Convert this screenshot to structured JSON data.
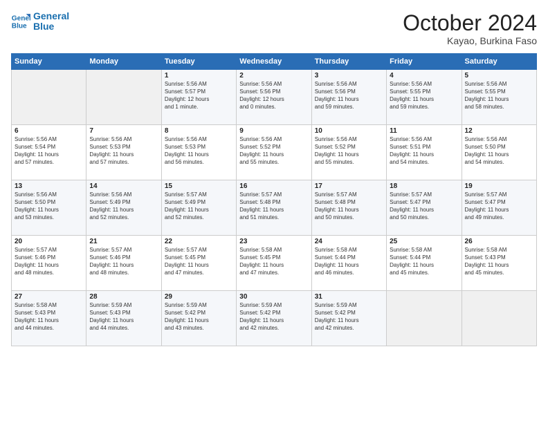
{
  "logo": {
    "line1": "General",
    "line2": "Blue"
  },
  "title": "October 2024",
  "location": "Kayao, Burkina Faso",
  "days_header": [
    "Sunday",
    "Monday",
    "Tuesday",
    "Wednesday",
    "Thursday",
    "Friday",
    "Saturday"
  ],
  "weeks": [
    [
      {
        "day": "",
        "info": ""
      },
      {
        "day": "",
        "info": ""
      },
      {
        "day": "1",
        "info": "Sunrise: 5:56 AM\nSunset: 5:57 PM\nDaylight: 12 hours\nand 1 minute."
      },
      {
        "day": "2",
        "info": "Sunrise: 5:56 AM\nSunset: 5:56 PM\nDaylight: 12 hours\nand 0 minutes."
      },
      {
        "day": "3",
        "info": "Sunrise: 5:56 AM\nSunset: 5:56 PM\nDaylight: 11 hours\nand 59 minutes."
      },
      {
        "day": "4",
        "info": "Sunrise: 5:56 AM\nSunset: 5:55 PM\nDaylight: 11 hours\nand 59 minutes."
      },
      {
        "day": "5",
        "info": "Sunrise: 5:56 AM\nSunset: 5:55 PM\nDaylight: 11 hours\nand 58 minutes."
      }
    ],
    [
      {
        "day": "6",
        "info": "Sunrise: 5:56 AM\nSunset: 5:54 PM\nDaylight: 11 hours\nand 57 minutes."
      },
      {
        "day": "7",
        "info": "Sunrise: 5:56 AM\nSunset: 5:53 PM\nDaylight: 11 hours\nand 57 minutes."
      },
      {
        "day": "8",
        "info": "Sunrise: 5:56 AM\nSunset: 5:53 PM\nDaylight: 11 hours\nand 56 minutes."
      },
      {
        "day": "9",
        "info": "Sunrise: 5:56 AM\nSunset: 5:52 PM\nDaylight: 11 hours\nand 55 minutes."
      },
      {
        "day": "10",
        "info": "Sunrise: 5:56 AM\nSunset: 5:52 PM\nDaylight: 11 hours\nand 55 minutes."
      },
      {
        "day": "11",
        "info": "Sunrise: 5:56 AM\nSunset: 5:51 PM\nDaylight: 11 hours\nand 54 minutes."
      },
      {
        "day": "12",
        "info": "Sunrise: 5:56 AM\nSunset: 5:50 PM\nDaylight: 11 hours\nand 54 minutes."
      }
    ],
    [
      {
        "day": "13",
        "info": "Sunrise: 5:56 AM\nSunset: 5:50 PM\nDaylight: 11 hours\nand 53 minutes."
      },
      {
        "day": "14",
        "info": "Sunrise: 5:56 AM\nSunset: 5:49 PM\nDaylight: 11 hours\nand 52 minutes."
      },
      {
        "day": "15",
        "info": "Sunrise: 5:57 AM\nSunset: 5:49 PM\nDaylight: 11 hours\nand 52 minutes."
      },
      {
        "day": "16",
        "info": "Sunrise: 5:57 AM\nSunset: 5:48 PM\nDaylight: 11 hours\nand 51 minutes."
      },
      {
        "day": "17",
        "info": "Sunrise: 5:57 AM\nSunset: 5:48 PM\nDaylight: 11 hours\nand 50 minutes."
      },
      {
        "day": "18",
        "info": "Sunrise: 5:57 AM\nSunset: 5:47 PM\nDaylight: 11 hours\nand 50 minutes."
      },
      {
        "day": "19",
        "info": "Sunrise: 5:57 AM\nSunset: 5:47 PM\nDaylight: 11 hours\nand 49 minutes."
      }
    ],
    [
      {
        "day": "20",
        "info": "Sunrise: 5:57 AM\nSunset: 5:46 PM\nDaylight: 11 hours\nand 48 minutes."
      },
      {
        "day": "21",
        "info": "Sunrise: 5:57 AM\nSunset: 5:46 PM\nDaylight: 11 hours\nand 48 minutes."
      },
      {
        "day": "22",
        "info": "Sunrise: 5:57 AM\nSunset: 5:45 PM\nDaylight: 11 hours\nand 47 minutes."
      },
      {
        "day": "23",
        "info": "Sunrise: 5:58 AM\nSunset: 5:45 PM\nDaylight: 11 hours\nand 47 minutes."
      },
      {
        "day": "24",
        "info": "Sunrise: 5:58 AM\nSunset: 5:44 PM\nDaylight: 11 hours\nand 46 minutes."
      },
      {
        "day": "25",
        "info": "Sunrise: 5:58 AM\nSunset: 5:44 PM\nDaylight: 11 hours\nand 45 minutes."
      },
      {
        "day": "26",
        "info": "Sunrise: 5:58 AM\nSunset: 5:43 PM\nDaylight: 11 hours\nand 45 minutes."
      }
    ],
    [
      {
        "day": "27",
        "info": "Sunrise: 5:58 AM\nSunset: 5:43 PM\nDaylight: 11 hours\nand 44 minutes."
      },
      {
        "day": "28",
        "info": "Sunrise: 5:59 AM\nSunset: 5:43 PM\nDaylight: 11 hours\nand 44 minutes."
      },
      {
        "day": "29",
        "info": "Sunrise: 5:59 AM\nSunset: 5:42 PM\nDaylight: 11 hours\nand 43 minutes."
      },
      {
        "day": "30",
        "info": "Sunrise: 5:59 AM\nSunset: 5:42 PM\nDaylight: 11 hours\nand 42 minutes."
      },
      {
        "day": "31",
        "info": "Sunrise: 5:59 AM\nSunset: 5:42 PM\nDaylight: 11 hours\nand 42 minutes."
      },
      {
        "day": "",
        "info": ""
      },
      {
        "day": "",
        "info": ""
      }
    ]
  ]
}
